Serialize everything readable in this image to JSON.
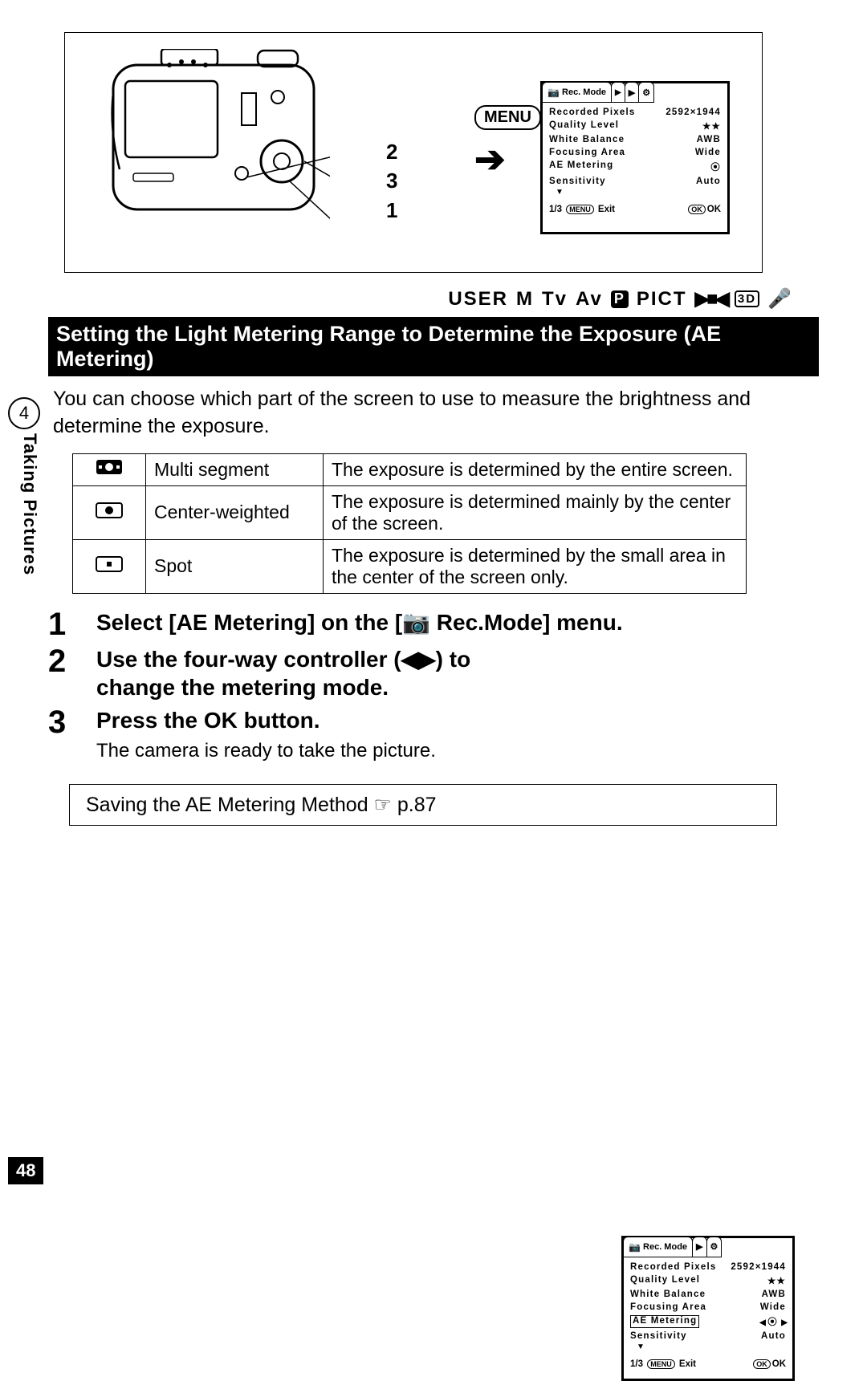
{
  "page_number": "48",
  "chapter_number": "4",
  "side_label": "Taking Pictures",
  "menu_button_label": "MENU",
  "callouts": {
    "a": "2",
    "b": "3",
    "c": "1"
  },
  "lcd1": {
    "title": "Rec. Mode",
    "rows": [
      {
        "label": "Recorded Pixels",
        "value": "2592×1944"
      },
      {
        "label": "Quality Level",
        "value": "★★"
      },
      {
        "label": "White Balance",
        "value": "AWB"
      },
      {
        "label": "Focusing Area",
        "value": "Wide"
      },
      {
        "label": "AE Metering",
        "value": "⦿"
      },
      {
        "label": "Sensitivity",
        "value": "Auto"
      }
    ],
    "foot_left_prefix": "1/3",
    "foot_menu": "MENU",
    "foot_left": "Exit",
    "foot_ok": "OK",
    "foot_right": "OK"
  },
  "mode_line": {
    "user": "USER",
    "m": "M",
    "tv": "Tv",
    "av": "Av",
    "p": "P",
    "pict": "PICT",
    "d3": "3D"
  },
  "section_title": "Setting the Light Metering Range to Determine the Exposure (AE Metering)",
  "intro": "You can choose which part of the screen to use to measure the brightness and determine the exposure.",
  "table": [
    {
      "icon": "⦿",
      "name": "Multi segment",
      "desc": "The exposure is determined by the entire screen."
    },
    {
      "icon": "◉",
      "name": "Center-weighted",
      "desc": "The exposure is determined mainly by the center of the screen."
    },
    {
      "icon": "▫",
      "name": "Spot",
      "desc": "The exposure is determined by the small area in the center of the screen only."
    }
  ],
  "steps": [
    {
      "n": "1",
      "bold": "Select [AE Metering] on the [📷 Rec.Mode] menu."
    },
    {
      "n": "2",
      "bold": "Use the four-way controller (◀▶) to change the metering mode."
    },
    {
      "n": "3",
      "bold": "Press the OK button.",
      "sub": "The camera is ready to take the picture."
    }
  ],
  "lcd2": {
    "title": "Rec. Mode",
    "rows": [
      {
        "label": "Recorded Pixels",
        "value": "2592×1944"
      },
      {
        "label": "Quality Level",
        "value": "★★"
      },
      {
        "label": "White Balance",
        "value": "AWB"
      },
      {
        "label": "Focusing Area",
        "value": "Wide"
      },
      {
        "label": "AE Metering",
        "value": "⦿",
        "hl": true
      },
      {
        "label": "Sensitivity",
        "value": "Auto"
      }
    ],
    "foot_left_prefix": "1/3",
    "foot_menu": "MENU",
    "foot_left": "Exit",
    "foot_ok": "OK",
    "foot_right": "OK"
  },
  "ref_text": "Saving the AE Metering Method ☞ p.87"
}
